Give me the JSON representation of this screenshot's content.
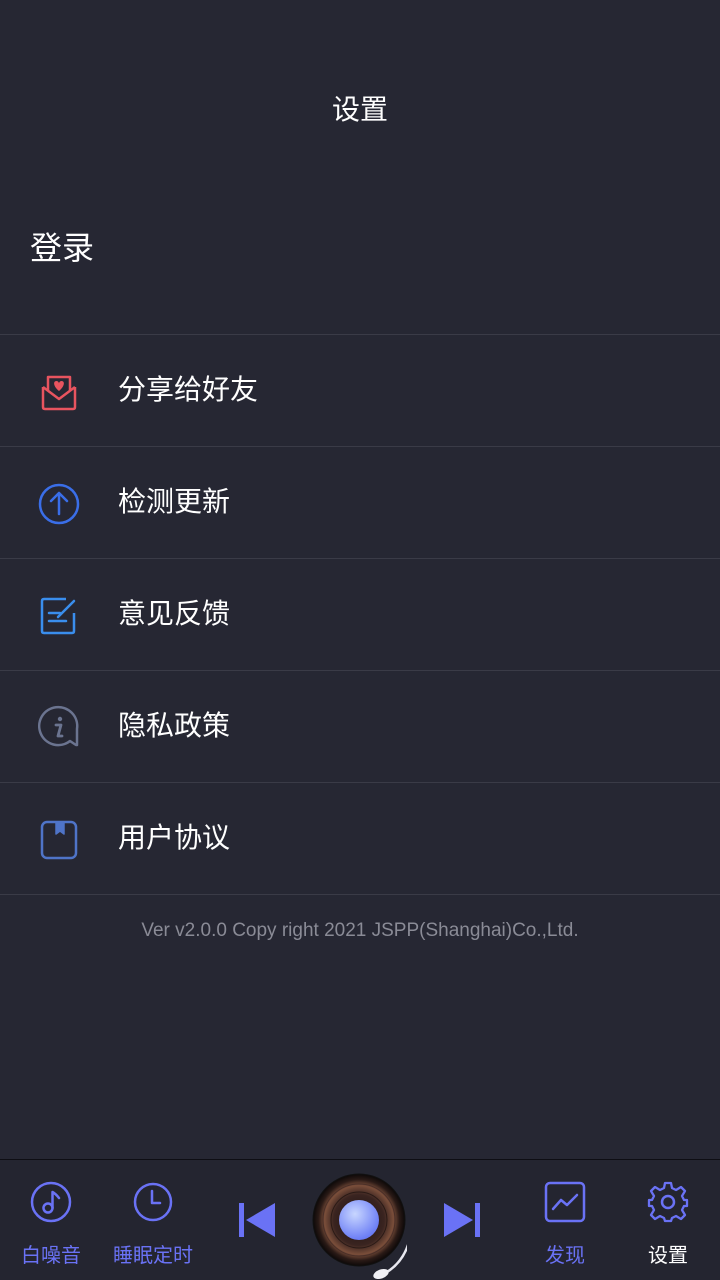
{
  "header": {
    "title": "设置"
  },
  "account": {
    "login_label": "登录"
  },
  "menu": {
    "items": [
      {
        "label": "分享给好友",
        "icon": "share-heart-mail-icon",
        "color": "#e8545f"
      },
      {
        "label": "检测更新",
        "icon": "upload-arrow-circle-icon",
        "color": "#3a6ee8"
      },
      {
        "label": "意见反馈",
        "icon": "edit-note-icon",
        "color": "#3a8eed"
      },
      {
        "label": "隐私政策",
        "icon": "info-chat-icon",
        "color": "#6b7490"
      },
      {
        "label": "用户协议",
        "icon": "bookmark-doc-icon",
        "color": "#4f74c8"
      }
    ]
  },
  "footer": {
    "version": "Ver v2.0.0 Copy right  2021 JSPP(Shanghai)Co.,Ltd."
  },
  "bottom_nav": {
    "tabs": [
      {
        "label": "白噪音",
        "icon": "music-note-icon"
      },
      {
        "label": "睡眠定时",
        "icon": "clock-icon"
      },
      {
        "label": "发现",
        "icon": "chart-trend-icon"
      },
      {
        "label": "设置",
        "icon": "gear-icon",
        "active": true
      }
    ],
    "controls": {
      "prev_icon": "skip-previous-icon",
      "next_icon": "skip-next-icon",
      "player_icon": "vinyl-record-icon"
    },
    "accent": "#6a72f5"
  }
}
